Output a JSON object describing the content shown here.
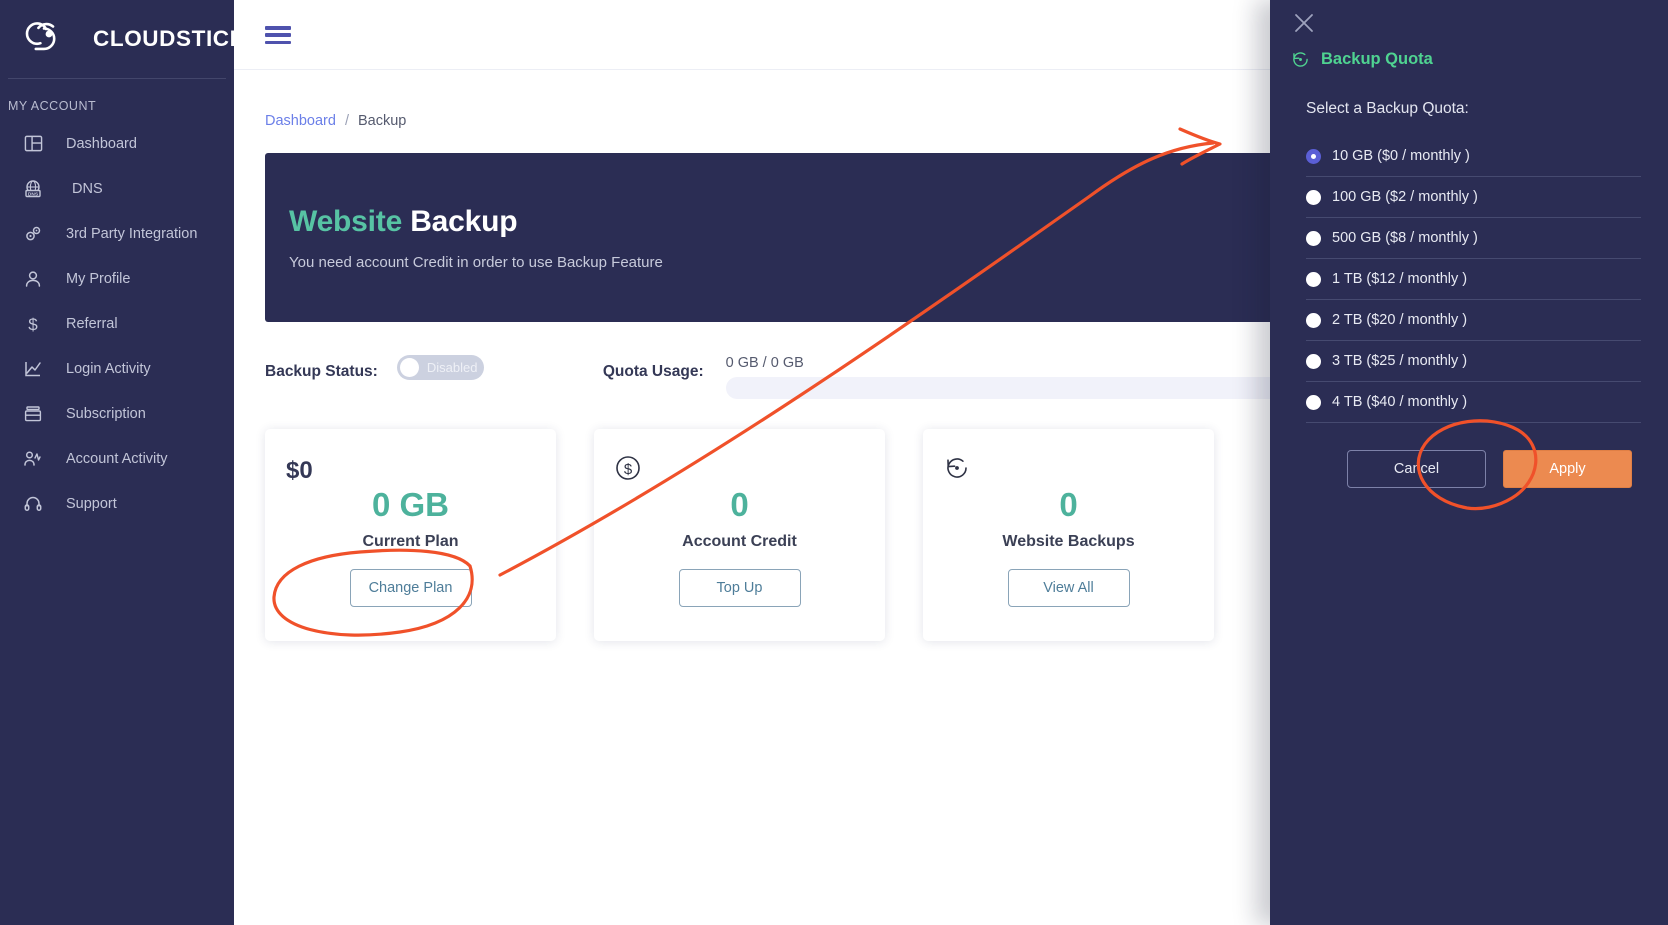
{
  "sidebar": {
    "brand": "CLOUDSTICK",
    "section_label": "MY ACCOUNT",
    "items": [
      {
        "label": "Dashboard",
        "icon": "dashboard-icon"
      },
      {
        "label": "DNS",
        "icon": "dns-globe-icon"
      },
      {
        "label": "3rd Party Integration",
        "icon": "gears-icon"
      },
      {
        "label": "My Profile",
        "icon": "user-icon"
      },
      {
        "label": "Referral",
        "icon": "dollar-icon"
      },
      {
        "label": "Login Activity",
        "icon": "line-chart-icon"
      },
      {
        "label": "Subscription",
        "icon": "drawer-icon"
      },
      {
        "label": "Account Activity",
        "icon": "user-activity-icon"
      },
      {
        "label": "Support",
        "icon": "headset-icon"
      }
    ]
  },
  "topbar": {
    "menu_icon": "hamburger-icon"
  },
  "breadcrumb": {
    "root": "Dashboard",
    "separator": "/",
    "current": "Backup"
  },
  "hero": {
    "title_accent": "Website",
    "title_rest": "Backup",
    "subtitle": "You need account Credit in order to use Backup Feature"
  },
  "status": {
    "label": "Backup Status:",
    "toggle_text": "Disabled",
    "toggle_on": false
  },
  "quota": {
    "label": "Quota Usage:",
    "value": "0 GB / 0 GB",
    "percent": 0
  },
  "cards": [
    {
      "corner_text": "$0",
      "corner_icon": null,
      "big": "0 GB",
      "caption": "Current Plan",
      "button": "Change Plan"
    },
    {
      "corner_text": null,
      "corner_icon": "dollar-circle-icon",
      "big": "0",
      "caption": "Account Credit",
      "button": "Top Up"
    },
    {
      "corner_text": null,
      "corner_icon": "restore-icon",
      "big": "0",
      "caption": "Website Backups",
      "button": "View All"
    }
  ],
  "panel": {
    "close_icon": "close-icon",
    "header_icon": "restore-icon",
    "title": "Backup Quota",
    "prompt": "Select a Backup Quota:",
    "options": [
      {
        "label": "10 GB ($0 / monthly )",
        "selected": true
      },
      {
        "label": "100 GB ($2 / monthly )",
        "selected": false
      },
      {
        "label": "500 GB ($8 / monthly )",
        "selected": false
      },
      {
        "label": "1 TB ($12 / monthly )",
        "selected": false
      },
      {
        "label": "2 TB ($20 / monthly )",
        "selected": false
      },
      {
        "label": "3 TB ($25 / monthly )",
        "selected": false
      },
      {
        "label": "4 TB ($40 / monthly )",
        "selected": false
      }
    ],
    "cancel_label": "Cancel",
    "apply_label": "Apply"
  },
  "annotations": {
    "stroke_color": "#f0512a",
    "marks": [
      "ellipse-around-change-plan-button",
      "arrow-from-change-plan-to-first-quota-option",
      "ellipse-around-apply-button"
    ]
  },
  "colors": {
    "sidebar_bg": "#2b2d54",
    "panel_bg": "#2b2d54",
    "accent_green": "#4fd391",
    "teal": "#4db29c",
    "apply_orange": "#ec8a50",
    "link_blue": "#6b7fe8",
    "radio_selected": "#5b5fd6"
  }
}
